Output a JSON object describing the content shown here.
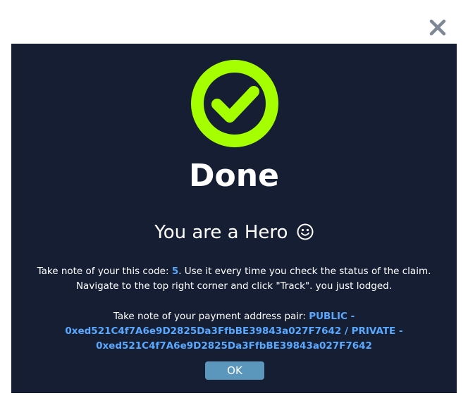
{
  "dialog": {
    "close_icon": "close-icon",
    "status_icon": "check-circle-icon",
    "title": "Done",
    "subtitle": "You are a Hero",
    "subtitle_icon": "smiley-icon",
    "code_line": {
      "prefix": "Take note of your this code: ",
      "code": "5",
      "suffix": ". Use it every time you check the status of the claim.",
      "line2": "Navigate to the top right corner and click \"Track\". you just lodged."
    },
    "address_line": {
      "prefix": "Take note of your payment address pair: ",
      "public_label": "PUBLIC - ",
      "public_address": "0xed521C4f7A6e9D2825Da3FfbBE39843a027F7642",
      "separator": " / ",
      "private_label": "PRIVATE - ",
      "private_address": "0xed521C4f7A6e9D2825Da3FfbBE39843a027F7642"
    },
    "ok_label": "OK",
    "colors": {
      "panel_bg": "#151e33",
      "accent_green": "#a6ff00",
      "highlight_blue": "#5aa9ff",
      "ok_button": "#5b97bd",
      "close_icon": "#7d8796"
    }
  }
}
